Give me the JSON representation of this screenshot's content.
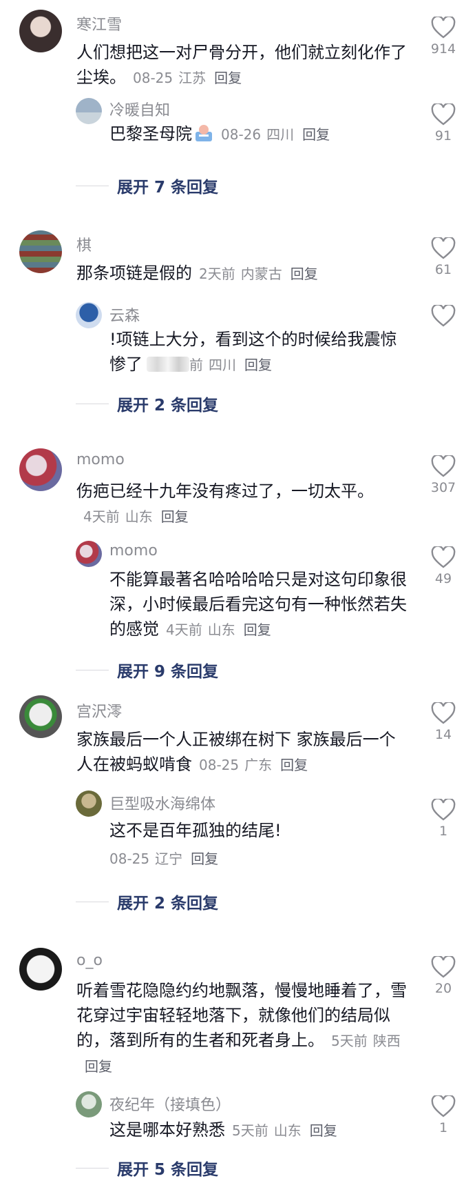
{
  "comments": [
    {
      "username": "寒江雪",
      "text": "人们想把这一对尸骨分开，他们就立刻化作了尘埃。",
      "date": "08-25",
      "location": "江苏",
      "reply_label": "回复",
      "likes": "914",
      "avatar_colors": [
        "#3a2e2e",
        "#d8c8c8"
      ],
      "sub": {
        "username": "冷暖自知",
        "text": "巴黎圣母院",
        "date": "08-26",
        "location": "四川",
        "reply_label": "回复",
        "likes": "91",
        "avatar_colors": [
          "#9fb3c8",
          "#d8e2ea"
        ],
        "emoji_icon": "cake-emoji-icon"
      },
      "expand_label": "展开 7 条回复"
    },
    {
      "username": "棋",
      "text": "那条项链是假的",
      "date": "2天前",
      "location": "内蒙古",
      "reply_label": "回复",
      "likes": "61",
      "avatar_colors": [
        "#8a3a30",
        "#4a7a8a"
      ],
      "sub": {
        "username": "云森",
        "text": "!项链上大分，看到这个的时候给我震惊惨了",
        "date": "前",
        "location": "四川",
        "reply_label": "回复",
        "likes": "",
        "avatar_colors": [
          "#2d5fa8",
          "#cfdcef"
        ]
      },
      "expand_label": "展开 2 条回复"
    },
    {
      "username": "momo",
      "text": "伤疤已经十九年没有疼过了，一切太平。",
      "date": "4天前",
      "location": "山东",
      "reply_label": "回复",
      "likes": "307",
      "avatar_colors": [
        "#b23a4a",
        "#e8d8e0"
      ],
      "sub": {
        "username": "momo",
        "text": "不能算最著名哈哈哈哈只是对这句印象很深，小时候最后看完这句有一种怅然若失的感觉",
        "date": "4天前",
        "location": "山东",
        "reply_label": "回复",
        "likes": "49",
        "avatar_colors": [
          "#b23a4a",
          "#e8d8e0"
        ]
      },
      "expand_label": "展开 9 条回复"
    },
    {
      "username": "宫沢澪",
      "text": "家族最后一个人正被绑在树下 家族最后一个人在被蚂蚁啃食",
      "date": "08-25",
      "location": "广东",
      "reply_label": "回复",
      "likes": "14",
      "avatar_colors": [
        "#3a8a3a",
        "#eeeeee"
      ],
      "sub": {
        "username": "巨型吸水海绵体",
        "text": "这不是百年孤独的结尾!",
        "date": "08-25",
        "location": "辽宁",
        "reply_label": "回复",
        "likes": "1",
        "avatar_colors": [
          "#6a6a3a",
          "#c8b890"
        ]
      },
      "expand_label": "展开 2 条回复"
    },
    {
      "username": "o_o",
      "text": "听着雪花隐隐约约地飘落，慢慢地睡着了，雪花穿过宇宙轻轻地落下，就像他们的结局似的，落到所有的生者和死者身上。",
      "date": "5天前",
      "location": "陕西",
      "reply_label": "回复",
      "likes": "20",
      "avatar_colors": [
        "#1a1a1a",
        "#f4f4f4"
      ],
      "sub": {
        "username": "夜纪年（接填色）",
        "text": "这是哪本好熟悉",
        "date": "5天前",
        "location": "山东",
        "reply_label": "回复",
        "likes": "1",
        "avatar_colors": [
          "#7a9a7a",
          "#e0e8e0"
        ]
      },
      "expand_label": "展开 5 条回复"
    }
  ],
  "icons": {
    "like": "heart-outline-icon"
  },
  "colors": {
    "text": "#161823",
    "meta": "#8a8b91",
    "expand": "#2a3b6b"
  }
}
